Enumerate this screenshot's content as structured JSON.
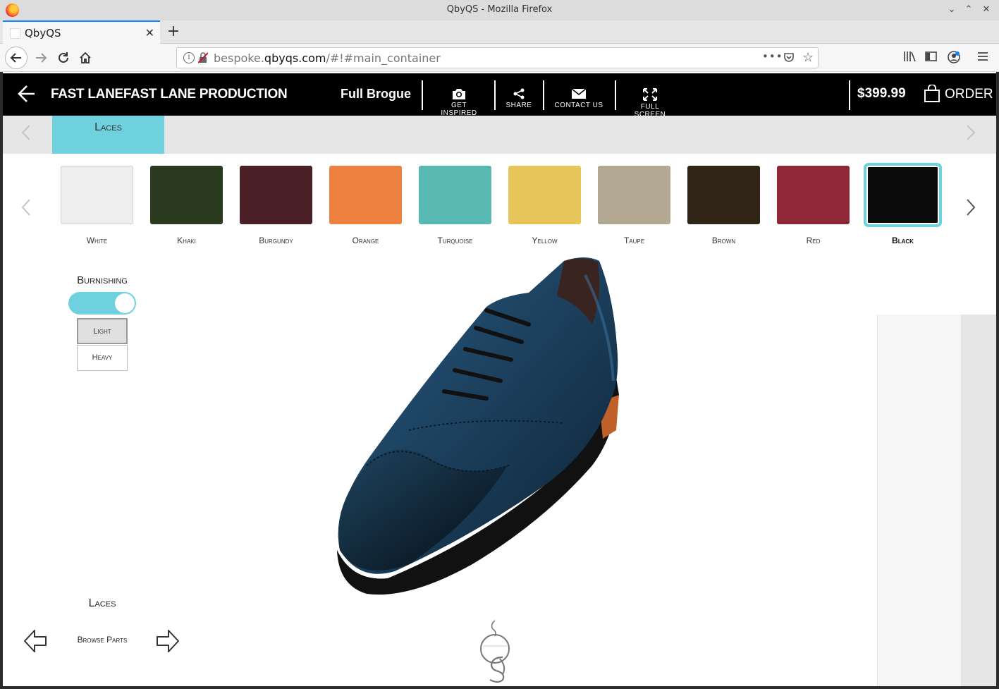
{
  "window": {
    "title": "QbyQS - Mozilla Firefox"
  },
  "tab": {
    "label": "QbyQS"
  },
  "address": {
    "prefix": "bespoke.",
    "domain": "qbyqs.com",
    "path": "/#!#main_container"
  },
  "header": {
    "brand": "FAST LANEFAST LANE PRODUCTION",
    "style_name": "Full Brogue",
    "tools": [
      {
        "label": "GET INSPIRED",
        "icon": "camera-icon"
      },
      {
        "label": "SHARE",
        "icon": "share-icon"
      },
      {
        "label": "CONTACT US",
        "icon": "envelope-icon"
      },
      {
        "label": "FULL SCREEN",
        "icon": "fullscreen-icon"
      }
    ],
    "price": "$399.99",
    "order_label": "ORDER"
  },
  "categories": {
    "active": "Laces"
  },
  "swatches": [
    {
      "label": "White",
      "color": "#eeeeee"
    },
    {
      "label": "Khaki",
      "color": "#2a3a1e"
    },
    {
      "label": "Burgundy",
      "color": "#4a1f26"
    },
    {
      "label": "Orange",
      "color": "#ee8040"
    },
    {
      "label": "Turquoise",
      "color": "#57b9b2"
    },
    {
      "label": "Yellow",
      "color": "#e8c55a"
    },
    {
      "label": "Taupe",
      "color": "#b3a891"
    },
    {
      "label": "Brown",
      "color": "#302517"
    },
    {
      "label": "Red",
      "color": "#8e2737"
    },
    {
      "label": "Black",
      "color": "#0b0b0b"
    }
  ],
  "selected_swatch": "Black",
  "burnishing": {
    "title": "Burnishing",
    "enabled": true,
    "options": [
      "Light",
      "Heavy"
    ],
    "selected": "Light"
  },
  "browse": {
    "part_label": "Laces",
    "browse_label": "Browse Parts"
  },
  "colors": {
    "accent": "#6fd0de",
    "header_bg": "#000000",
    "shoe": "#1b3f5c"
  }
}
